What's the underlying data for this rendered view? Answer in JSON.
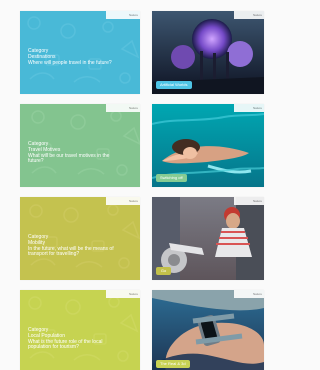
{
  "cards": [
    {
      "category": "Category",
      "title": "Destinations",
      "question": "Where will people travel in the future?",
      "tag": "Nature",
      "caption": "Artificial Worlds",
      "colors": {
        "card": "#49b9d7",
        "pattern": "#7dd3ea",
        "photo_top": "#3d5670",
        "photo_bottom": "#0e1323",
        "caption": "#4fc4e6"
      }
    },
    {
      "category": "Category",
      "title": "Travel Motives",
      "question": "What will be our travel motives in the future?",
      "tag": "Nature",
      "caption": "Switching off",
      "colors": {
        "card": "#83c48f",
        "pattern": "#ace0b4",
        "photo_top": "#00a7b2",
        "photo_bottom": "#06758a",
        "caption": "#86cb93"
      }
    },
    {
      "category": "Category",
      "title": "Mobility",
      "question": "In the future, what will be the means of transport for travelling?",
      "tag": "Nature",
      "caption": "Go",
      "colors": {
        "card": "#c4c24f",
        "pattern": "#ddd77b",
        "photo_top": "#7b7b85",
        "photo_bottom": "#5e555b",
        "caption": "#c2c04a"
      }
    },
    {
      "category": "Category",
      "title": "Local Population",
      "question": "What is the future role of the local population for tourism?",
      "tag": "Nature",
      "caption": "The Real & 3d",
      "colors": {
        "card": "#c6d351",
        "pattern": "#dde27d",
        "photo_top": "#2d6f96",
        "photo_bottom": "#1d3351",
        "caption": "#c8d255"
      }
    }
  ]
}
